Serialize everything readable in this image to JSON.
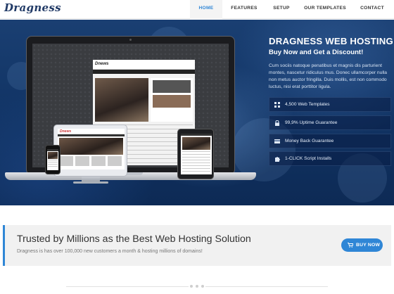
{
  "header": {
    "logo_text": "Dragness",
    "nav": [
      {
        "label": "HOME",
        "active": true
      },
      {
        "label": "FEATURES",
        "active": false
      },
      {
        "label": "SETUP",
        "active": false
      },
      {
        "label": "OUR TEMPLATES",
        "active": false
      },
      {
        "label": "CONTACT",
        "active": false
      }
    ]
  },
  "hero": {
    "title": "DRAGNESS WEB HOSTING",
    "subtitle": "Buy Now and Get a Discount!",
    "description": "Cum sociis natoque penatibus et magnis dis parturient montes, nascetur ridiculus mus. Donec ullamcorper nulla non metus auctor fringilla. Duis mollis, est non commodo luctus, nisi erat porttitor ligula.",
    "features": [
      {
        "label": "4,500 Web Templates",
        "icon": "grid-icon"
      },
      {
        "label": "99,9% Uptime Guarantee",
        "icon": "lock-icon"
      },
      {
        "label": "Money Back Guarantee",
        "icon": "credit-card-icon"
      },
      {
        "label": "1-CLICK Script Installs",
        "icon": "puzzle-icon"
      }
    ],
    "mockup_logo": "Dnews"
  },
  "cta": {
    "title": "Trusted by Millions as the Best Web Hosting Solution",
    "description": "Dragness is has over 100,000 new customers a month & hosting millions of domains!",
    "button_label": "BUY NOW",
    "button_icon": "cart-icon"
  },
  "colors": {
    "accent": "#2f86d6",
    "hero_dark": "#0d2a55",
    "logo": "#213a66"
  }
}
